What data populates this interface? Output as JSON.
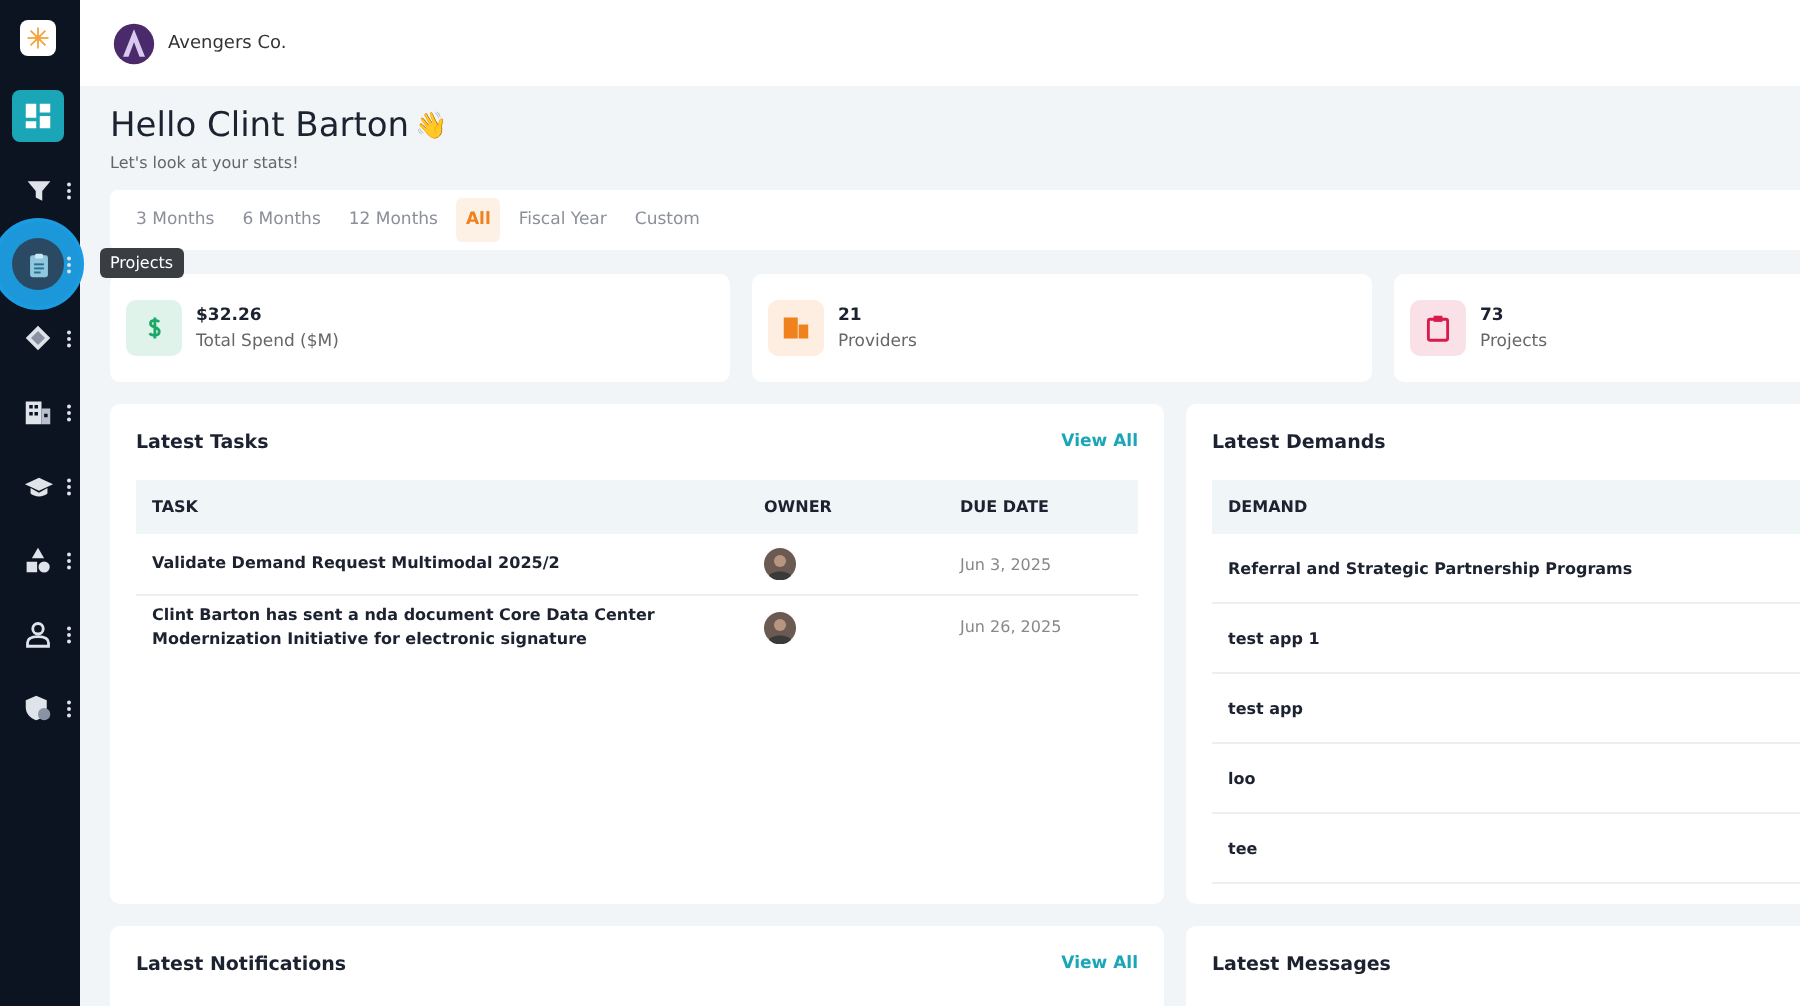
{
  "sidebar": {
    "items": [
      {
        "selected": true,
        "highlighted": false,
        "has_menu": false
      },
      {
        "selected": false,
        "highlighted": false,
        "has_menu": true
      },
      {
        "selected": false,
        "highlighted": true,
        "has_menu": true
      },
      {
        "selected": false,
        "highlighted": false,
        "has_menu": true
      },
      {
        "selected": false,
        "highlighted": false,
        "has_menu": true
      },
      {
        "selected": false,
        "highlighted": false,
        "has_menu": true
      },
      {
        "selected": false,
        "highlighted": false,
        "has_menu": true
      },
      {
        "selected": false,
        "highlighted": false,
        "has_menu": true
      },
      {
        "selected": false,
        "highlighted": false,
        "has_menu": true
      }
    ],
    "tooltip": "Projects"
  },
  "header": {
    "company": "Avengers Co."
  },
  "greeting": {
    "title": "Hello Clint Barton",
    "emoji": "👋",
    "subtitle": "Let's look at your stats!"
  },
  "periods": [
    {
      "label": "3 Months",
      "selected": false
    },
    {
      "label": "6 Months",
      "selected": false
    },
    {
      "label": "12 Months",
      "selected": false
    },
    {
      "label": "All",
      "selected": true
    },
    {
      "label": "Fiscal Year",
      "selected": false
    },
    {
      "label": "Custom",
      "selected": false
    }
  ],
  "stats": [
    {
      "value": "$32.26",
      "label": "Total Spend ($M)",
      "color": "#1aa867"
    },
    {
      "value": "21",
      "label": "Providers",
      "color": "#f0821e"
    },
    {
      "value": "73",
      "label": "Projects",
      "color": "#d81b4a"
    }
  ],
  "tasks": {
    "title": "Latest Tasks",
    "link": "View All",
    "columns": [
      "TASK",
      "OWNER",
      "DUE DATE"
    ],
    "rows": [
      {
        "task": "Validate Demand Request Multimodal 2025/2",
        "due": "Jun 3, 2025"
      },
      {
        "task": "Clint Barton has sent a nda document Core Data Center Modernization Initiative for electronic signature",
        "due": "Jun 26, 2025"
      }
    ]
  },
  "demands": {
    "title": "Latest Demands",
    "columns": [
      "DEMAND"
    ],
    "rows": [
      "Referral and Strategic Partnership Programs",
      "test app 1",
      "test app",
      "loo",
      "tee"
    ]
  },
  "notifications": {
    "title": "Latest Notifications",
    "link": "View All"
  },
  "messages": {
    "title": "Latest Messages"
  }
}
